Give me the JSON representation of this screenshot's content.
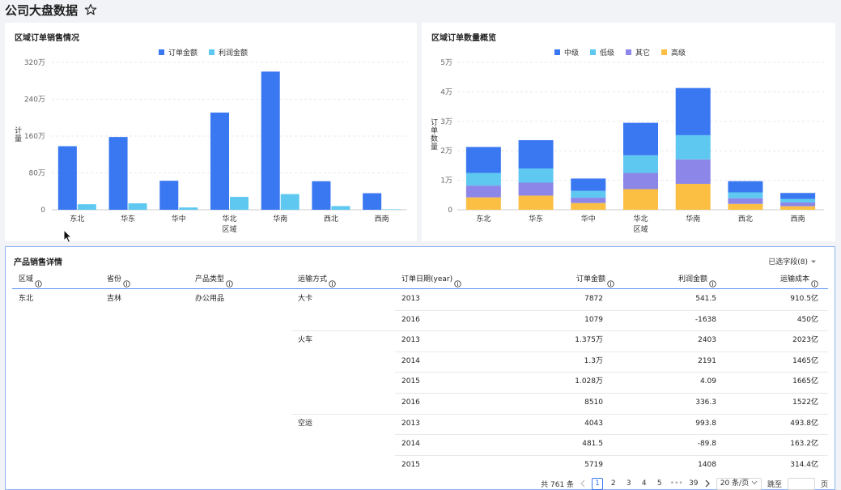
{
  "page": {
    "title": "公司大盘数据"
  },
  "colors": {
    "blue": "#3a78f2",
    "lightblue": "#5ec8f0",
    "purple": "#8c86e8",
    "orange": "#fbbf44",
    "grid": "#e5e5e5"
  },
  "chart_left": {
    "title": "区域订单销售情况",
    "legend": [
      "订单金额",
      "利润金额"
    ],
    "chart_data": {
      "type": "bar",
      "categories": [
        "东北",
        "华东",
        "华中",
        "华北",
        "华南",
        "西北",
        "西南"
      ],
      "series": [
        {
          "name": "订单金额",
          "values": [
            1380000,
            1580000,
            630000,
            2110000,
            3000000,
            620000,
            360000
          ]
        },
        {
          "name": "利润金额",
          "values": [
            120000,
            140000,
            50000,
            280000,
            340000,
            80000,
            10000
          ]
        }
      ],
      "yticks": [
        "0",
        "80万",
        "160万",
        "240万",
        "320万"
      ],
      "ylim": [
        0,
        3200000
      ],
      "xlabel": "区域",
      "ylabel": "计量"
    }
  },
  "chart_right": {
    "title": "区域订单数量概览",
    "legend": [
      "中级",
      "低级",
      "其它",
      "高级"
    ],
    "chart_data": {
      "type": "bar",
      "stacked": true,
      "categories": [
        "东北",
        "华东",
        "华中",
        "华北",
        "华南",
        "西北",
        "西南"
      ],
      "series": [
        {
          "name": "高级",
          "values": [
            4200,
            4800,
            2300,
            7000,
            8800,
            2000,
            1200
          ]
        },
        {
          "name": "其它",
          "values": [
            4000,
            4400,
            1800,
            5500,
            8300,
            1900,
            1300
          ]
        },
        {
          "name": "低级",
          "values": [
            4300,
            4800,
            2300,
            6000,
            8200,
            2000,
            1200
          ]
        },
        {
          "name": "中级",
          "values": [
            8800,
            9600,
            4200,
            11000,
            16000,
            3800,
            2000
          ]
        }
      ],
      "yticks": [
        "0",
        "1万",
        "2万",
        "3万",
        "4万",
        "5万"
      ],
      "ylim": [
        0,
        50000
      ],
      "xlabel": "区域",
      "ylabel": "订单数量"
    }
  },
  "table": {
    "title": "产品销售详情",
    "field_select": "已选字段(8)",
    "columns": [
      "区域",
      "省份",
      "产品类型",
      "运输方式",
      "订单日期(year)",
      "订单金额",
      "利润金额",
      "运输成本"
    ],
    "group": {
      "region": "东北",
      "province": "吉林",
      "product": "办公用品"
    },
    "rows": [
      {
        "ship": "大卡",
        "year": "2013",
        "amount": "7872",
        "profit": "541.5",
        "cost": "910.5亿"
      },
      {
        "ship": "",
        "year": "2016",
        "amount": "1079",
        "profit": "-1638",
        "cost": "450亿"
      },
      {
        "ship": "火车",
        "year": "2013",
        "amount": "1.375万",
        "profit": "2403",
        "cost": "2023亿"
      },
      {
        "ship": "",
        "year": "2014",
        "amount": "1.3万",
        "profit": "2191",
        "cost": "1465亿"
      },
      {
        "ship": "",
        "year": "2015",
        "amount": "1.028万",
        "profit": "4.09",
        "cost": "1665亿"
      },
      {
        "ship": "",
        "year": "2016",
        "amount": "8510",
        "profit": "336.3",
        "cost": "1522亿"
      },
      {
        "ship": "空运",
        "year": "2013",
        "amount": "4043",
        "profit": "993.8",
        "cost": "493.8亿"
      },
      {
        "ship": "",
        "year": "2014",
        "amount": "481.5",
        "profit": "-89.8",
        "cost": "163.2亿"
      },
      {
        "ship": "",
        "year": "2015",
        "amount": "5719",
        "profit": "1408",
        "cost": "314.4亿"
      }
    ],
    "pager": {
      "total": "共 761 条",
      "pages": [
        "1",
        "2",
        "3",
        "4",
        "5"
      ],
      "ellipsis": "•••",
      "last": "39",
      "size": "20 条/页",
      "jump_label": "跳至",
      "page_suffix": "页"
    }
  }
}
